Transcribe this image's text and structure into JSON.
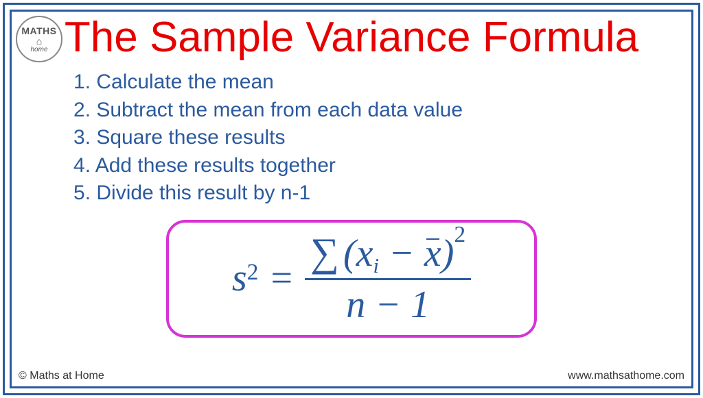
{
  "logo": {
    "top": "MATHS",
    "bottom": "home"
  },
  "title": "The Sample Variance Formula",
  "steps": [
    "Calculate the mean",
    "Subtract the mean from each data value",
    "Square these results",
    "Add these results together",
    "Divide this result by n-1"
  ],
  "formula": {
    "lhs_var": "s",
    "lhs_exp": "2",
    "equals": "=",
    "sigma": "∑",
    "lparen": "(",
    "xi_base": "x",
    "xi_sub": "i",
    "minus": " − ",
    "xbar": "x",
    "rparen": ")",
    "num_exp": "2",
    "den_n": "n",
    "den_minus": " − ",
    "den_one": "1"
  },
  "footer": {
    "left": "© Maths at Home",
    "right": "www.mathsathome.com"
  }
}
